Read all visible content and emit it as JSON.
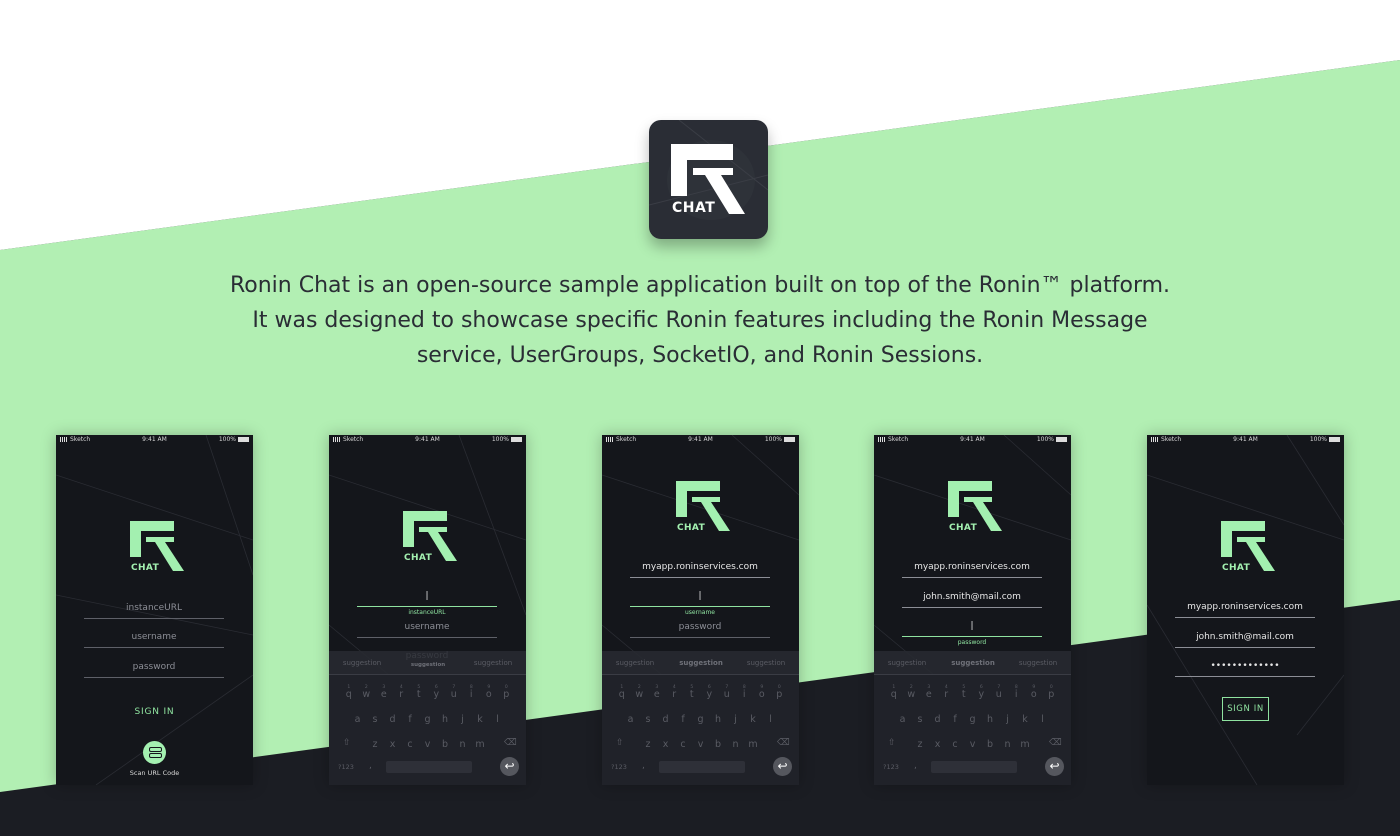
{
  "colors": {
    "accent_green": "#b2efb3",
    "dark_bg": "#1b1d23",
    "phone_bg": "#14161b",
    "brand_green": "#a3f0b0"
  },
  "app_icon": {
    "logo_text": "CHAT",
    "icon": "ronin-r-logo-icon"
  },
  "description": {
    "line1": "Ronin Chat is an open-source sample application built on top of the Ronin™ platform.",
    "line2": "It was designed to showcase specific Ronin features including the Ronin Message",
    "line3": "service, UserGroups, SocketIO, and Ronin Sessions."
  },
  "status_bar": {
    "carrier": "Sketch",
    "time": "9:41 AM",
    "battery": "100%"
  },
  "logo_text": "CHAT",
  "keyboard": {
    "suggestion_left": "suggestion",
    "suggestion_mid": "suggestion",
    "suggestion_right": "suggestion",
    "number_row": [
      "1",
      "2",
      "3",
      "4",
      "5",
      "6",
      "7",
      "8",
      "9",
      "0"
    ],
    "row1": [
      "q",
      "w",
      "e",
      "r",
      "t",
      "y",
      "u",
      "i",
      "o",
      "p"
    ],
    "row2": [
      "a",
      "s",
      "d",
      "f",
      "g",
      "h",
      "j",
      "k",
      "l"
    ],
    "row3": [
      "z",
      "x",
      "c",
      "v",
      "b",
      "n",
      "m"
    ],
    "numbers_key": "?123",
    "comma_key": ",",
    "return_icon": "return-arrow-icon"
  },
  "screens": [
    {
      "instance_placeholder": "instanceURL",
      "username_placeholder": "username",
      "password_placeholder": "password",
      "signin_label": "SIGN IN",
      "scan_label": "Scan URL Code"
    },
    {
      "cursor": "|",
      "instance_label": "instanceURL",
      "username_placeholder": "username",
      "password_placeholder": "password",
      "behind_suggestion": "suggestion"
    },
    {
      "instance_value": "myapp.roninservices.com",
      "cursor": "|",
      "username_label": "username",
      "password_placeholder": "password"
    },
    {
      "instance_value": "myapp.roninservices.com",
      "username_value": "john.smith@mail.com",
      "cursor": "|",
      "password_label": "password"
    },
    {
      "instance_value": "myapp.roninservices.com",
      "username_value": "john.smith@mail.com",
      "password_value": "•••••••••••••",
      "signin_label": "SIGN IN"
    }
  ]
}
